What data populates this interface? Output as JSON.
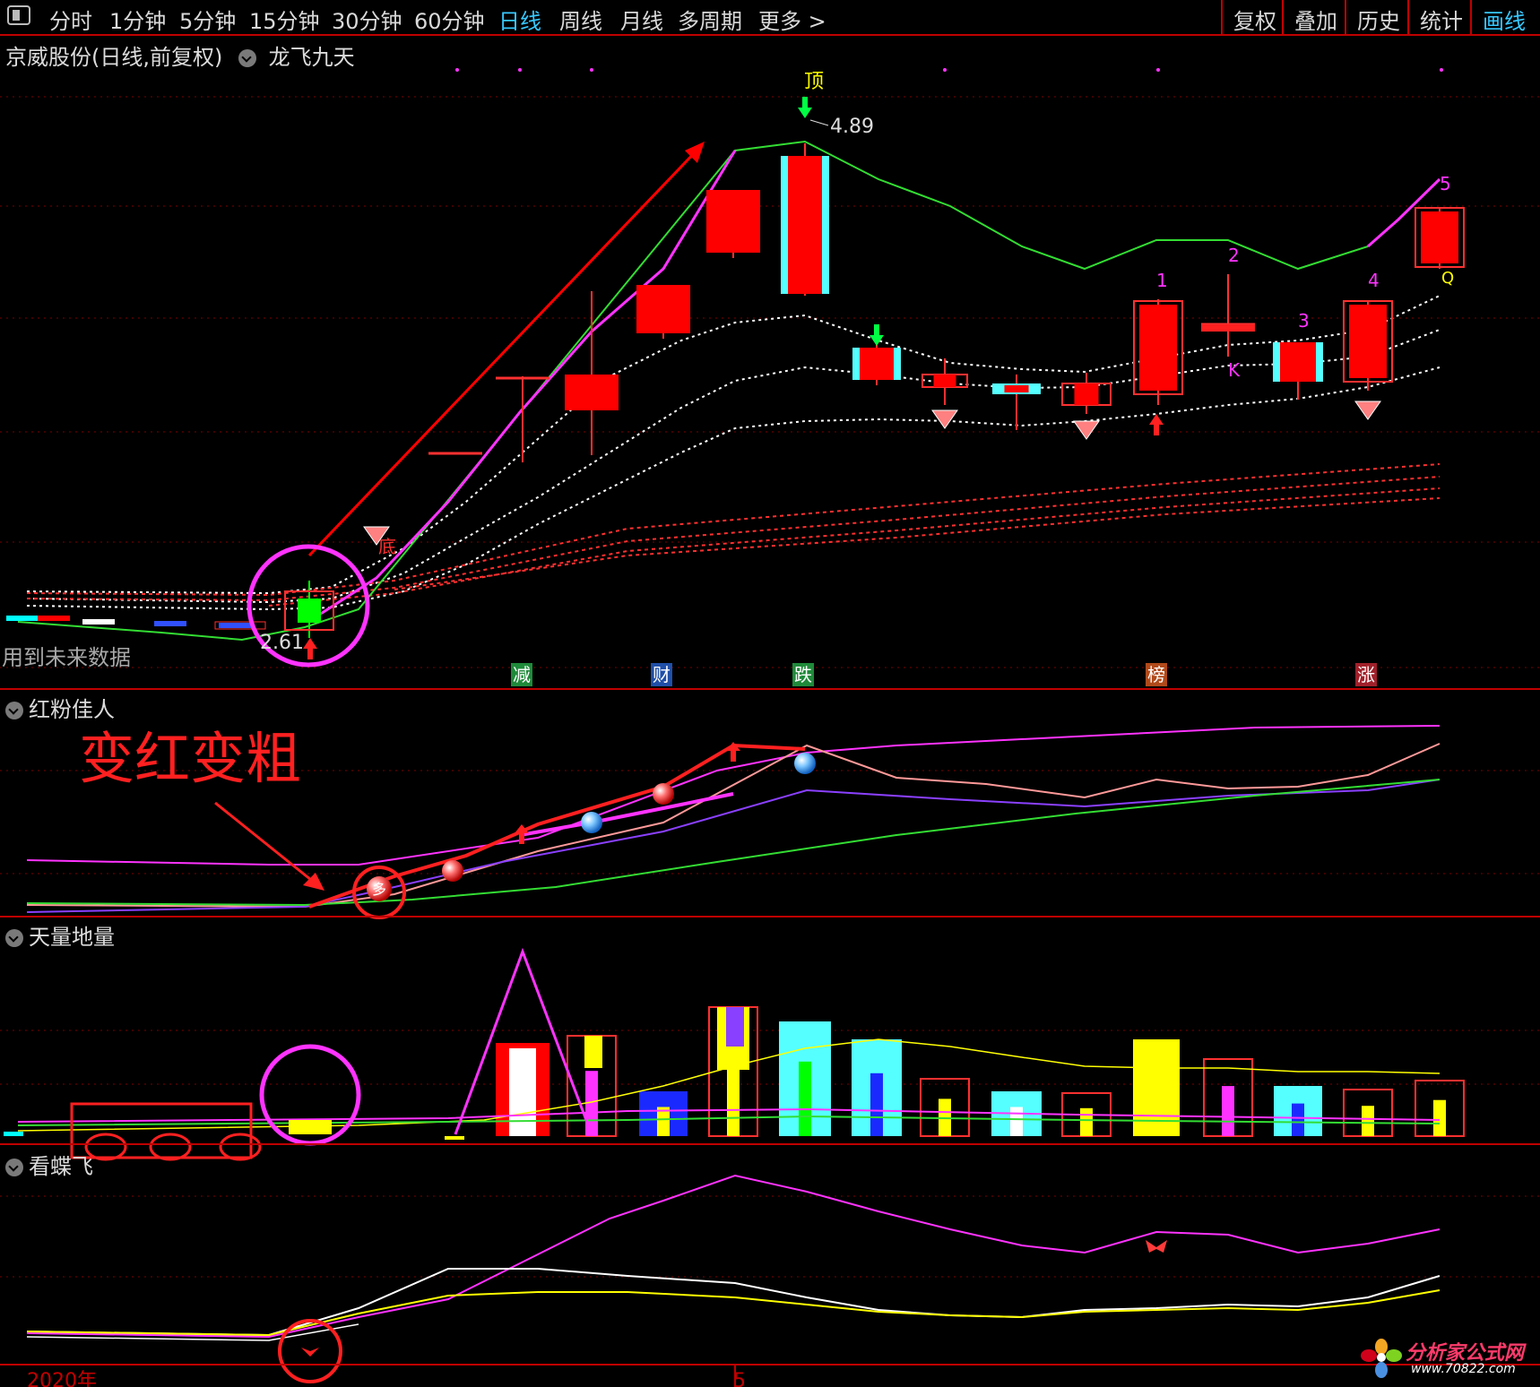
{
  "toolbar": {
    "periods": [
      "分时",
      "1分钟",
      "5分钟",
      "15分钟",
      "30分钟",
      "60分钟",
      "日线",
      "周线",
      "月线",
      "多周期",
      "更多 >"
    ],
    "active_period": "日线",
    "right_buttons": [
      "复权",
      "叠加",
      "历史",
      "统计",
      "画线"
    ],
    "active_right": "画线"
  },
  "main_panel": {
    "title": "京威股份(日线,前复权)",
    "indicator": "龙飞九天",
    "warning": "用到未来数据",
    "high_label": "4.89",
    "low_label": "2.61",
    "top_marker": "顶",
    "bottom_marker": "底",
    "wave_labels": [
      "1",
      "2",
      "3",
      "4",
      "5"
    ],
    "k_label": "K",
    "q_label": "Q",
    "event_tags": [
      {
        "text": "减",
        "color": "#1f8a3a"
      },
      {
        "text": "财",
        "color": "#1f4fa8"
      },
      {
        "text": "跌",
        "color": "#1f8a3a"
      },
      {
        "text": "榜",
        "color": "#b04a1a"
      },
      {
        "text": "涨",
        "color": "#a0202a"
      }
    ]
  },
  "panel2": {
    "title": "红粉佳人",
    "annotation": "变红变粗",
    "pill_text": "多"
  },
  "panel3": {
    "title": "天量地量"
  },
  "panel4": {
    "title": "看蝶飞"
  },
  "xaxis": {
    "year_label": "2020年",
    "month_label": "5"
  },
  "watermark": {
    "name": "分析家公式网",
    "url": "www.70822.com"
  },
  "colors": {
    "up": "#ff0000",
    "down": "#00ffff",
    "magenta": "#ff33ff",
    "green": "#33dd33",
    "pink": "#ff9999",
    "purple": "#8a40ff",
    "white": "#ffffff",
    "yellow": "#ffff00",
    "red_grid": "#c00000",
    "active": "#37c8ff"
  }
}
